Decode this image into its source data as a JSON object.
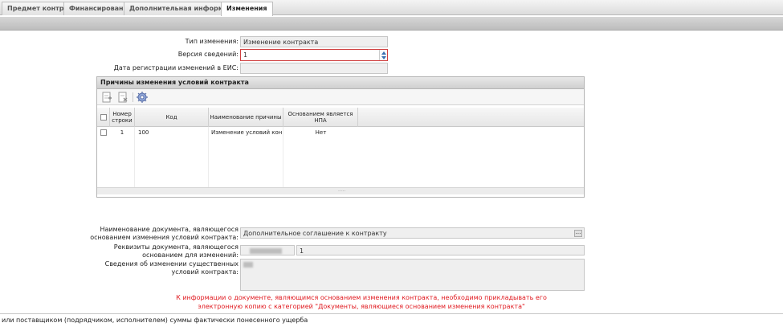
{
  "tabs": [
    {
      "label": "Предмет контракта"
    },
    {
      "label": "Финансирование"
    },
    {
      "label": "Дополнительная информация"
    },
    {
      "label": "Изменения"
    }
  ],
  "form": {
    "change_type_label": "Тип изменения:",
    "change_type_value": "Изменение контракта",
    "version_label": "Версия сведений:",
    "version_value": "1",
    "reg_date_label": "Дата регистрации изменений в ЕИС:",
    "reg_date_value": ""
  },
  "reasons_panel": {
    "title": "Причины изменения условий контракта",
    "columns": [
      "Номер строки",
      "Код",
      "Наименование причины",
      "Основанием является НПА"
    ],
    "rows": [
      {
        "num": "1",
        "code": "100",
        "name": "Изменение условий конт...",
        "npa": "Нет"
      }
    ],
    "footer_grip": "....."
  },
  "document": {
    "name_label": "Наименование документа, являющегося основанием изменения условий контракта:",
    "name_value": "Дополнительное соглашение к контракту",
    "name_button": "...",
    "details_label": "Реквизиты документа, являющегося основанием для изменений:",
    "details_number": "1",
    "info_label": "Сведения об изменении существенных условий контракта:"
  },
  "warning": "К информации о документе, являющимся основанием изменения контракта, необходимо прикладывать его электронную копию с категорией \"Документы, являющиеся основанием изменения контракта\"",
  "bottom_text": "или поставщиком (подрядчиком, исполнителем) суммы фактически понесенного ущерба"
}
